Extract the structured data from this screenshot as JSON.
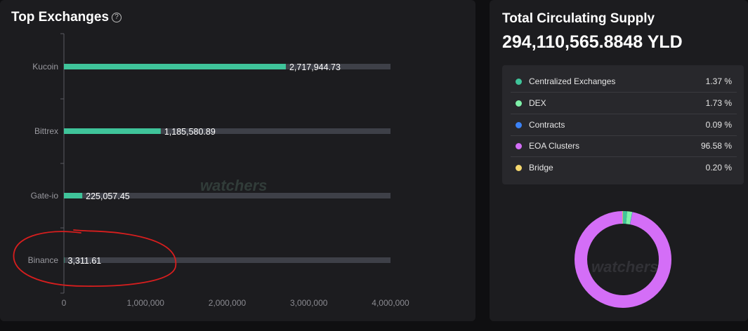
{
  "top_exchanges": {
    "title": "Top Exchanges",
    "help_icon": "?",
    "watermark": "watchers"
  },
  "chart_data": {
    "type": "bar",
    "orientation": "horizontal",
    "categories": [
      "Kucoin",
      "Bittrex",
      "Gate-io",
      "Binance"
    ],
    "values": [
      2717944.73,
      1185580.89,
      225057.45,
      3311.61
    ],
    "value_labels": [
      "2,717,944.73",
      "1,185,580.89",
      "225,057.45",
      "3,311.61"
    ],
    "xlim": [
      0,
      4000000
    ],
    "xticks": [
      0,
      1000000,
      2000000,
      3000000,
      4000000
    ],
    "xtick_labels": [
      "0",
      "1,000,000",
      "2,000,000",
      "3,000,000",
      "4,000,000"
    ],
    "grid": false,
    "colors": {
      "bar": "#3fc49a",
      "track": "#3e4048"
    }
  },
  "annotation": {
    "shape": "hand-drawn circle",
    "color": "#d81e1e",
    "target": "Binance"
  },
  "supply": {
    "title": "Total Circulating Supply",
    "value": "294,110,565.8848 YLD",
    "watermark": "watchers",
    "items": [
      {
        "name": "Centralized Exchanges",
        "value": "1.37 %",
        "percent": 1.37,
        "color": "#3fc49a"
      },
      {
        "name": "DEX",
        "value": "1.73 %",
        "percent": 1.73,
        "color": "#7ef0a8"
      },
      {
        "name": "Contracts",
        "value": "0.09 %",
        "percent": 0.09,
        "color": "#3b82f6"
      },
      {
        "name": "EOA Clusters",
        "value": "96.58 %",
        "percent": 96.58,
        "color": "#d46ef7"
      },
      {
        "name": "Bridge",
        "value": "0.20 %",
        "percent": 0.2,
        "color": "#f5d76e"
      }
    ]
  }
}
